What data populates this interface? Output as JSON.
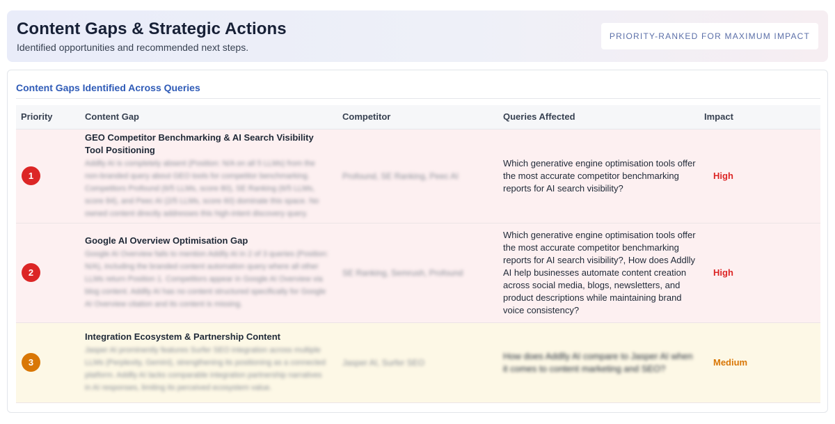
{
  "header": {
    "title": "Content Gaps & Strategic Actions",
    "subtitle": "Identified opportunities and recommended next steps.",
    "badge": "PRIORITY-RANKED FOR MAXIMUM IMPACT"
  },
  "card": {
    "title": "Content Gaps Identified Across Queries"
  },
  "table": {
    "columns": [
      "Priority",
      "Content Gap",
      "Competitor",
      "Queries Affected",
      "Impact"
    ],
    "rows": [
      {
        "priority": "1",
        "gap_title": "GEO Competitor Benchmarking & AI Search Visibility Tool Positioning",
        "gap_desc": "Addlly AI is completely absent (Position: N/A on all 5 LLMs) from the non-branded query about GEO tools for competitor benchmarking. Competitors Profound (6/5 LLMs, score 80), SE Ranking (6/5 LLMs, score 84), and Peec AI (2/5 LLMs, score 60) dominate this space. No owned content directly addresses this high-intent discovery query.",
        "competitor": "Profound, SE Ranking, Peec AI",
        "queries": "Which generative engine optimisation tools offer the most accurate competitor benchmarking reports for AI search visibility?",
        "impact": "High",
        "level": "high"
      },
      {
        "priority": "2",
        "gap_title": "Google AI Overview Optimisation Gap",
        "gap_desc": "Google AI Overview fails to mention Addlly AI in 2 of 3 queries (Position: N/A), including the branded content automation query where all other LLMs return Position 1. Competitors appear in Google AI Overview via blog content. Addlly AI has no content structured specifically for Google AI Overview citation and its content is missing.",
        "competitor": "SE Ranking, Semrush, Profound",
        "queries": "Which generative engine optimisation tools offer the most accurate competitor benchmarking reports for AI search visibility?, How does Addlly AI help businesses automate content creation across social media, blogs, newsletters, and product descriptions while maintaining brand voice consistency?",
        "impact": "High",
        "level": "high"
      },
      {
        "priority": "3",
        "gap_title": "Integration Ecosystem & Partnership Content",
        "gap_desc": "Jasper AI prominently features Surfer SEO integration across multiple LLMs (Perplexity, Gemini), strengthening its positioning as a connected platform. Addlly AI lacks comparable integration partnership narratives in AI responses, limiting its perceived ecosystem value.",
        "competitor": "Jasper AI, Surfer SEO",
        "queries": "How does Addlly AI compare to Jasper AI when it comes to content marketing and SEO?",
        "impact": "Medium",
        "level": "medium"
      }
    ]
  },
  "colors": {
    "high": "#dc2626",
    "medium": "#d97706",
    "accent": "#2f5bb7"
  }
}
